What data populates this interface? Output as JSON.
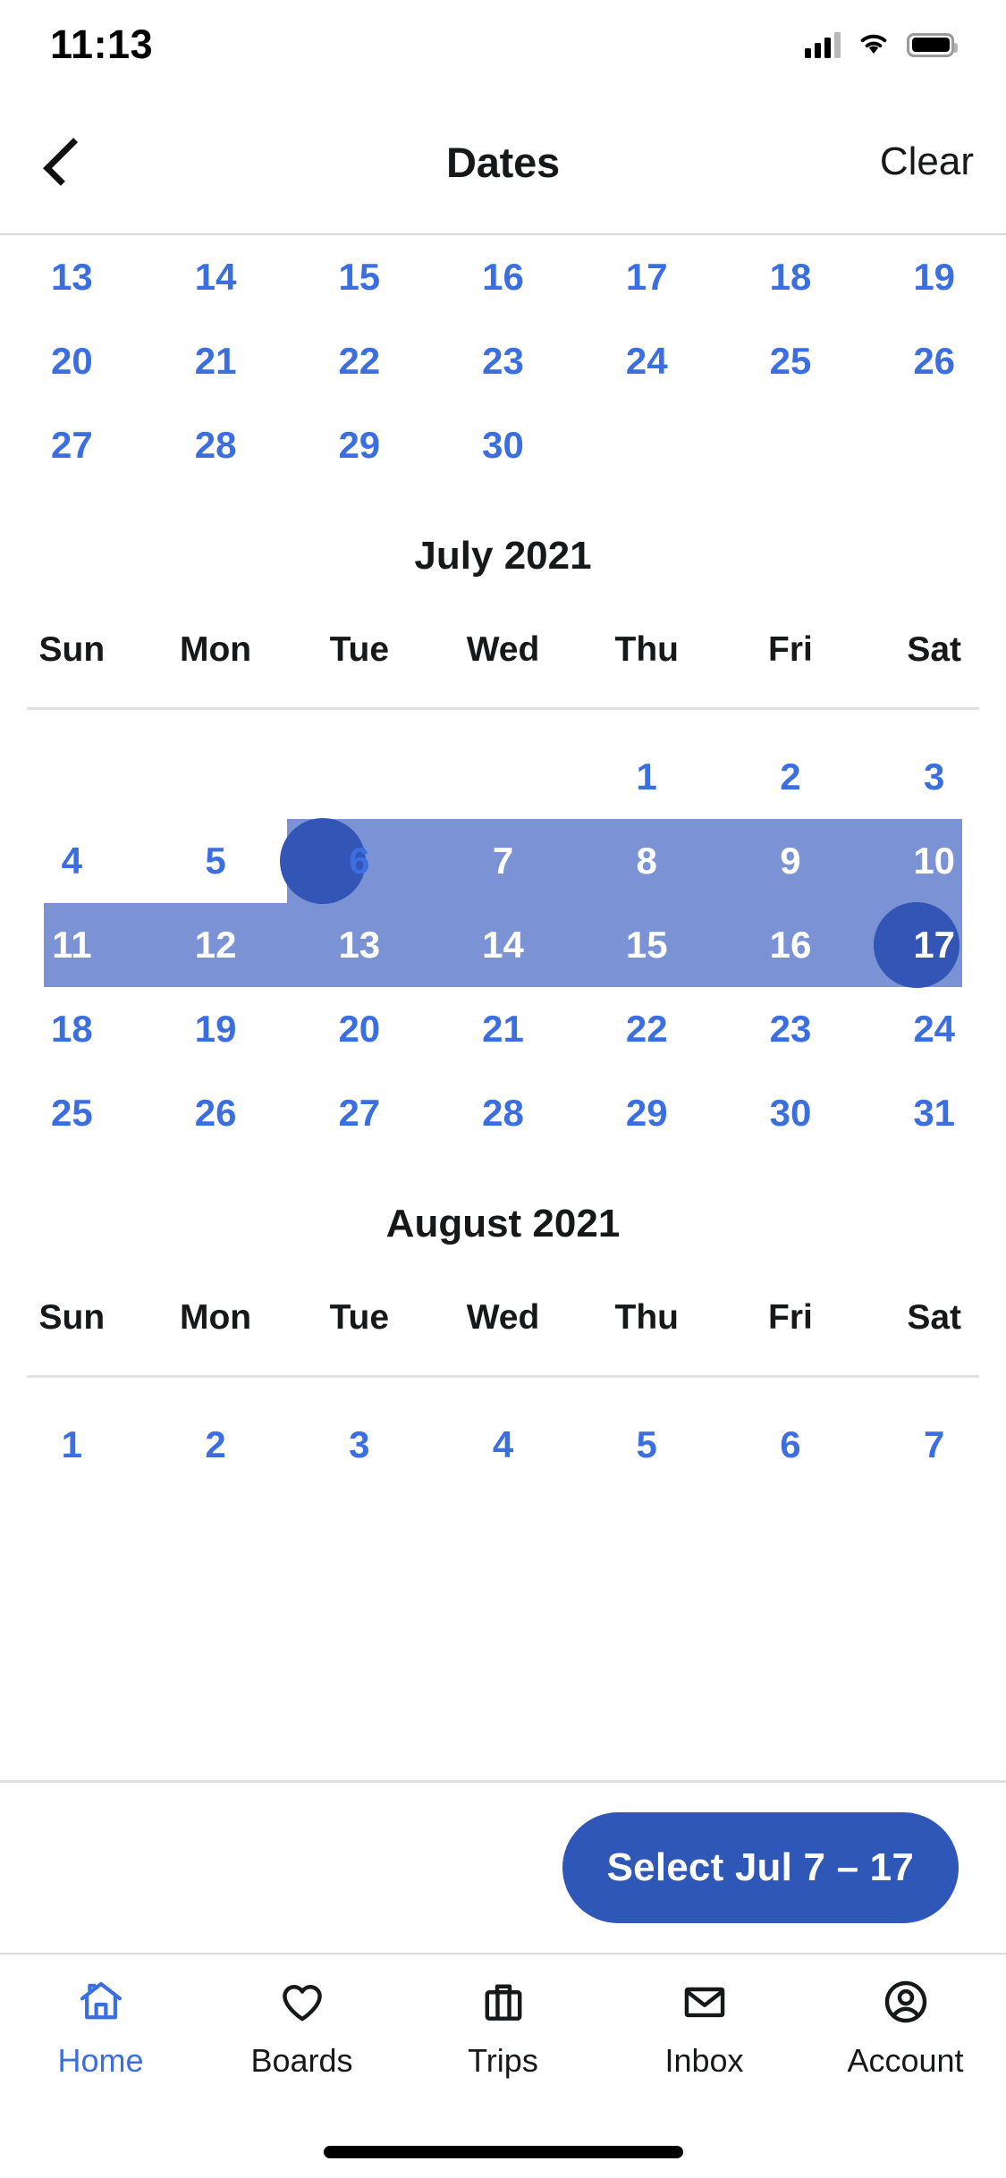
{
  "status_bar": {
    "time": "11:13",
    "signal_icon": "signal-bars-icon",
    "wifi_icon": "wifi-icon",
    "battery_icon": "battery-icon"
  },
  "header": {
    "back_icon": "chevron-left-icon",
    "title": "Dates",
    "clear_label": "Clear"
  },
  "theme": {
    "accent": "#3b6fe0",
    "range_band": "#7b93d4",
    "edge_circle": "#3355b5",
    "cta_background": "#2f57b8",
    "text_dark": "#17181a"
  },
  "calendar": {
    "weekday_labels": [
      "Sun",
      "Mon",
      "Tue",
      "Wed",
      "Thu",
      "Fri",
      "Sat"
    ],
    "partial_month_rows": [
      [
        "13",
        "14",
        "15",
        "16",
        "17",
        "18",
        "19"
      ],
      [
        "20",
        "21",
        "22",
        "23",
        "24",
        "25",
        "26"
      ],
      [
        "27",
        "28",
        "29",
        "30",
        "",
        "",
        ""
      ]
    ],
    "months": [
      {
        "title": "July 2021",
        "weeks": [
          [
            "",
            "",
            "",
            "",
            "1",
            "2",
            "3"
          ],
          [
            "4",
            "5",
            "6",
            "7",
            "8",
            "9",
            "10"
          ],
          [
            "11",
            "12",
            "13",
            "14",
            "15",
            "16",
            "17"
          ],
          [
            "18",
            "19",
            "20",
            "21",
            "22",
            "23",
            "24"
          ],
          [
            "25",
            "26",
            "27",
            "28",
            "29",
            "30",
            "31"
          ]
        ]
      },
      {
        "title": "August 2021",
        "weeks": [
          [
            "1",
            "2",
            "3",
            "4",
            "5",
            "6",
            "7"
          ]
        ]
      }
    ],
    "selection": {
      "start_label": "7",
      "end_label": "17",
      "in_range_labels": [
        "8",
        "9",
        "10",
        "11",
        "12",
        "13",
        "14",
        "15",
        "16"
      ]
    }
  },
  "footer": {
    "cta_label": "Select Jul 7 – 17"
  },
  "tabbar": {
    "items": [
      {
        "label": "Home",
        "icon": "home-icon",
        "active": true
      },
      {
        "label": "Boards",
        "icon": "heart-icon",
        "active": false
      },
      {
        "label": "Trips",
        "icon": "briefcase-icon",
        "active": false
      },
      {
        "label": "Inbox",
        "icon": "envelope-icon",
        "active": false
      },
      {
        "label": "Account",
        "icon": "account-circle-icon",
        "active": false
      }
    ]
  }
}
